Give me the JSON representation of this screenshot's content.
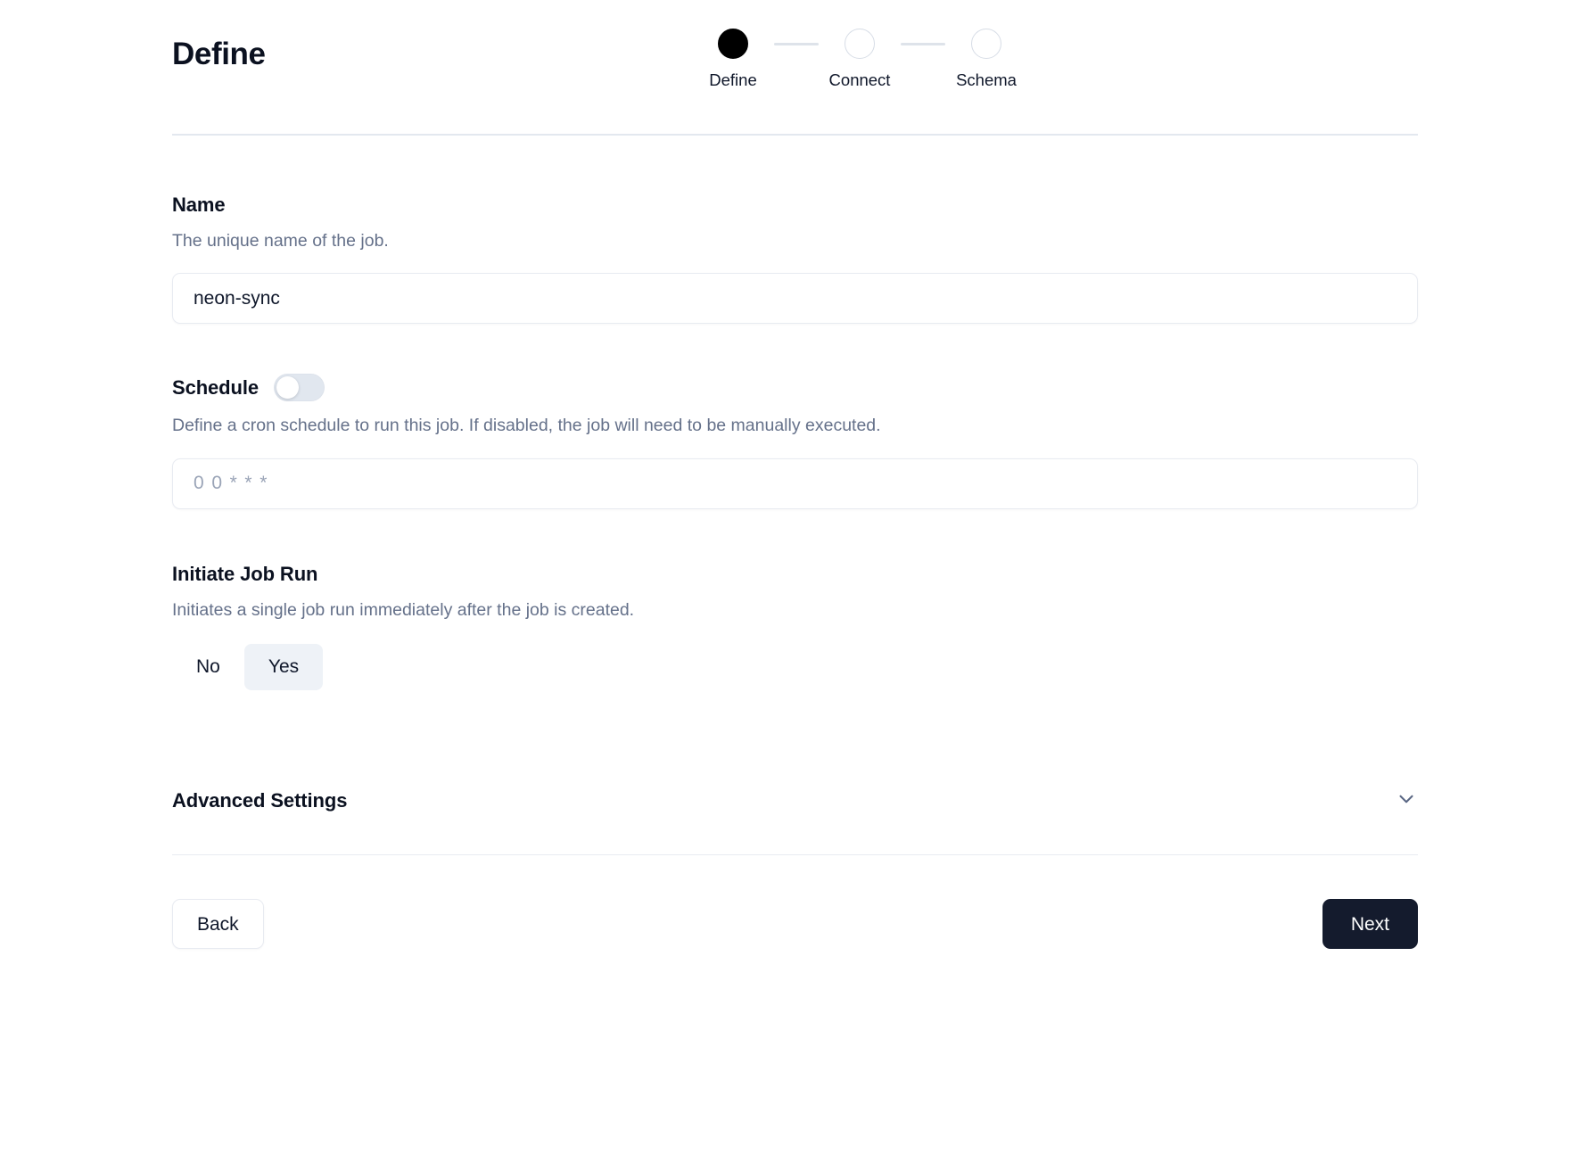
{
  "header": {
    "title": "Define",
    "steps": [
      {
        "label": "Define",
        "state": "active"
      },
      {
        "label": "Connect",
        "state": "inactive"
      },
      {
        "label": "Schema",
        "state": "inactive"
      }
    ]
  },
  "form": {
    "name": {
      "label": "Name",
      "description": "The unique name of the job.",
      "value": "neon-sync",
      "placeholder": ""
    },
    "schedule": {
      "label": "Schedule",
      "description": "Define a cron schedule to run this job. If disabled, the job will need to be manually executed.",
      "enabled": false,
      "cron_value": "",
      "cron_placeholder": "0 0 * * *"
    },
    "initiate_job_run": {
      "label": "Initiate Job Run",
      "description": "Initiates a single job run immediately after the job is created.",
      "options": [
        "No",
        "Yes"
      ],
      "selected": "Yes"
    },
    "advanced_settings": {
      "title": "Advanced Settings",
      "expand_icon": "chevron-down-icon",
      "expanded": false
    }
  },
  "footer": {
    "back_label": "Back",
    "next_label": "Next"
  },
  "colors": {
    "accent_dark": "#141b2d",
    "muted_text": "#65718a",
    "border": "#e8ebf1",
    "selected_bg": "#eef2f7"
  }
}
